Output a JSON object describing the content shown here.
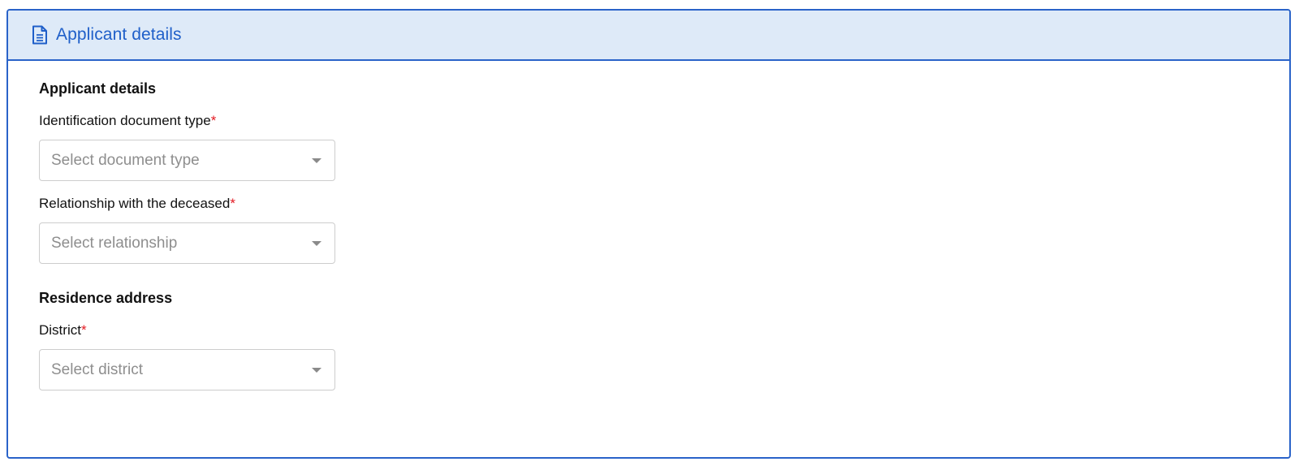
{
  "panel": {
    "title": "Applicant details",
    "icon": "document-icon"
  },
  "applicant_section": {
    "title": "Applicant details",
    "fields": [
      {
        "label": "Identification document type",
        "required_marker": "*",
        "placeholder": "Select document type"
      },
      {
        "label": "Relationship with the deceased",
        "required_marker": "*",
        "placeholder": "Select relationship"
      }
    ]
  },
  "residence_section": {
    "title": "Residence address",
    "fields": [
      {
        "label": "District",
        "required_marker": "*",
        "placeholder": "Select district"
      }
    ]
  },
  "colors": {
    "accent": "#2a63c9",
    "header_bg": "#deeaf8",
    "required": "#e31b23",
    "placeholder": "#8e8e8e"
  }
}
